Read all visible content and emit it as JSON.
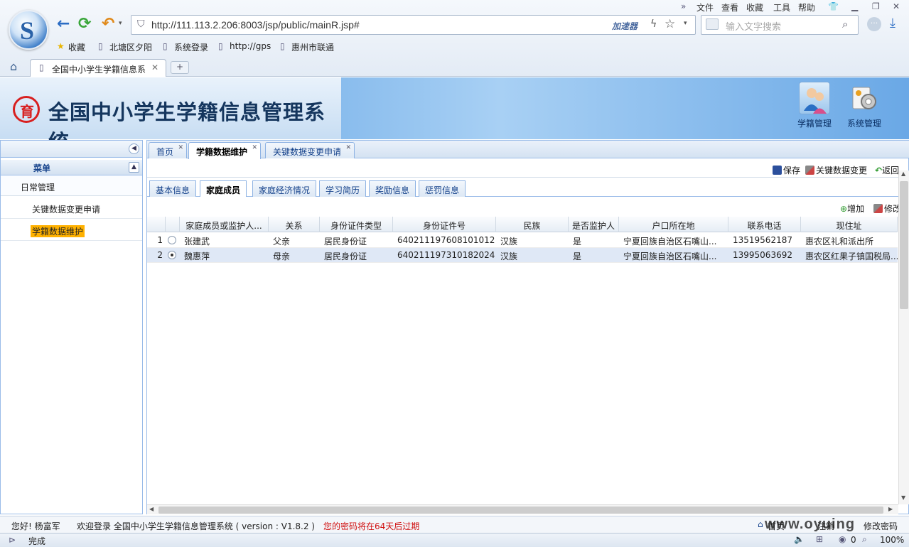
{
  "browser": {
    "menu": [
      "文件",
      "查看",
      "收藏",
      "工具",
      "帮助"
    ],
    "url": "http://111.113.2.206:8003/jsp/public/mainR.jsp#",
    "accelerator": "加速器",
    "search_placeholder": "输入文字搜索",
    "favorites": [
      "收藏",
      "北塘区夕阳",
      "系统登录",
      "http://gps",
      "惠州市联通"
    ],
    "tab_title": "全国中小学生学籍信息系",
    "new_tab": "+",
    "status": "完成",
    "zoom": "100%",
    "status_count": "0"
  },
  "app": {
    "title": "全国中小学生学籍信息管理系统",
    "emblem_char": "育",
    "modules": [
      {
        "label": "学籍管理",
        "icon": "users-icon"
      },
      {
        "label": "系统管理",
        "icon": "settings-gear-icon"
      }
    ]
  },
  "sidebar": {
    "header": "菜单",
    "group": "日常管理",
    "items": [
      "关键数据变更申请",
      "学籍数据维护"
    ],
    "active_index": 1
  },
  "main_tabs": [
    "首页",
    "学籍数据维护",
    "关键数据变更申请"
  ],
  "toolbar": {
    "save": "保存",
    "key_change": "关键数据变更",
    "back": "返回"
  },
  "sub_tabs": [
    "基本信息",
    "家庭成员",
    "家庭经济情况",
    "学习简历",
    "奖励信息",
    "惩罚信息"
  ],
  "grid_toolbar": {
    "add": "增加",
    "edit": "修改"
  },
  "grid": {
    "columns": [
      "家庭成员或监护人...",
      "关系",
      "身份证件类型",
      "身份证件号",
      "民族",
      "是否监护人",
      "户口所在地",
      "联系电话",
      "现住址"
    ],
    "rows": [
      {
        "no": "1",
        "selected": false,
        "cells": [
          "张建武",
          "父亲",
          "居民身份证",
          "640211197608101012",
          "汉族",
          "是",
          "宁夏回族自治区石嘴山...",
          "13519562187",
          "惠农区礼和派出所"
        ]
      },
      {
        "no": "2",
        "selected": true,
        "cells": [
          "魏惠萍",
          "母亲",
          "居民身份证",
          "640211197310182024",
          "汉族",
          "是",
          "宁夏回族自治区石嘴山...",
          "13995063692",
          "惠农区红果子镇国税局..."
        ]
      }
    ]
  },
  "footer": {
    "greeting": "您好! 杨富军",
    "welcome": "欢迎登录  全国中小学生学籍信息管理系统 ( version : V1.8.2 )",
    "warning": "您的密码将在64天后过期",
    "home": "首页",
    "exit": "注销",
    "change_password": "修改密码",
    "watermark": "www.oyuing"
  },
  "colors": {
    "accent_blue": "#15428b",
    "active_item_bg": "#ffb100",
    "warning_red": "#d01010",
    "emblem_red": "#d81f1f"
  }
}
